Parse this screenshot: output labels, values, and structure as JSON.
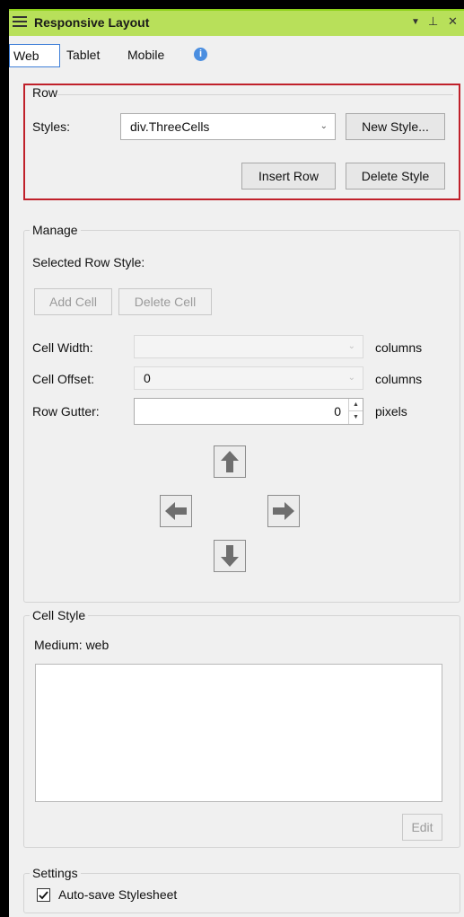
{
  "panel": {
    "title": "Responsive Layout",
    "dropdown_glyph": "▼",
    "pin_glyph": "⊥",
    "close_glyph": "✕"
  },
  "tabs": [
    "Web",
    "Tablet",
    "Mobile"
  ],
  "row": {
    "legend": "Row",
    "styles_label": "Styles:",
    "styles_value": "div.ThreeCells",
    "new_style": "New Style...",
    "insert_row": "Insert Row",
    "delete_style": "Delete Style"
  },
  "manage": {
    "legend": "Manage",
    "selected_label": "Selected Row Style:",
    "add_cell": "Add Cell",
    "delete_cell": "Delete Cell",
    "cell_width_label": "Cell Width:",
    "cell_width_value": "",
    "cell_offset_label": "Cell Offset:",
    "cell_offset_value": "0",
    "row_gutter_label": "Row Gutter:",
    "row_gutter_value": "0",
    "columns": "columns",
    "pixels": "pixels"
  },
  "cell_style": {
    "legend": "Cell Style",
    "medium": "Medium: web",
    "edit": "Edit"
  },
  "settings": {
    "legend": "Settings",
    "autosave": "Auto-save Stylesheet",
    "autosave_checked": true
  },
  "colors": {
    "title_bar": "#b8e05a",
    "highlight_border": "#c0202a",
    "info": "#4a8ee0"
  }
}
